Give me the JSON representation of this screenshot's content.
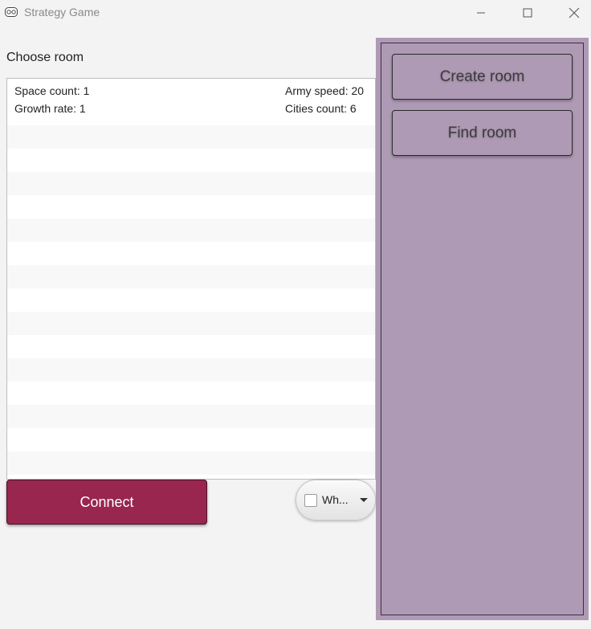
{
  "window": {
    "title": "Strategy Game",
    "app_icon": "gamepad-icon",
    "controls": [
      "minimize-icon",
      "maximize-icon",
      "close-icon"
    ]
  },
  "rooms": {
    "label": "Choose room",
    "items": [
      {
        "space_count": "Space count: 1",
        "growth_rate": "Growth rate: 1",
        "army_speed": "Army speed: 20",
        "cities_count": "Cities count: 6"
      }
    ],
    "empty_rows": 15
  },
  "actions": {
    "connect_label": "Connect",
    "filter_label": "Wh...",
    "filter_checked": false
  },
  "side_panel": {
    "create_room_label": "Create room",
    "find_room_label": "Find room"
  },
  "colors": {
    "connect_button": "#98264f",
    "side_panel": "#af9ab5",
    "background": "#f3f3f3"
  }
}
